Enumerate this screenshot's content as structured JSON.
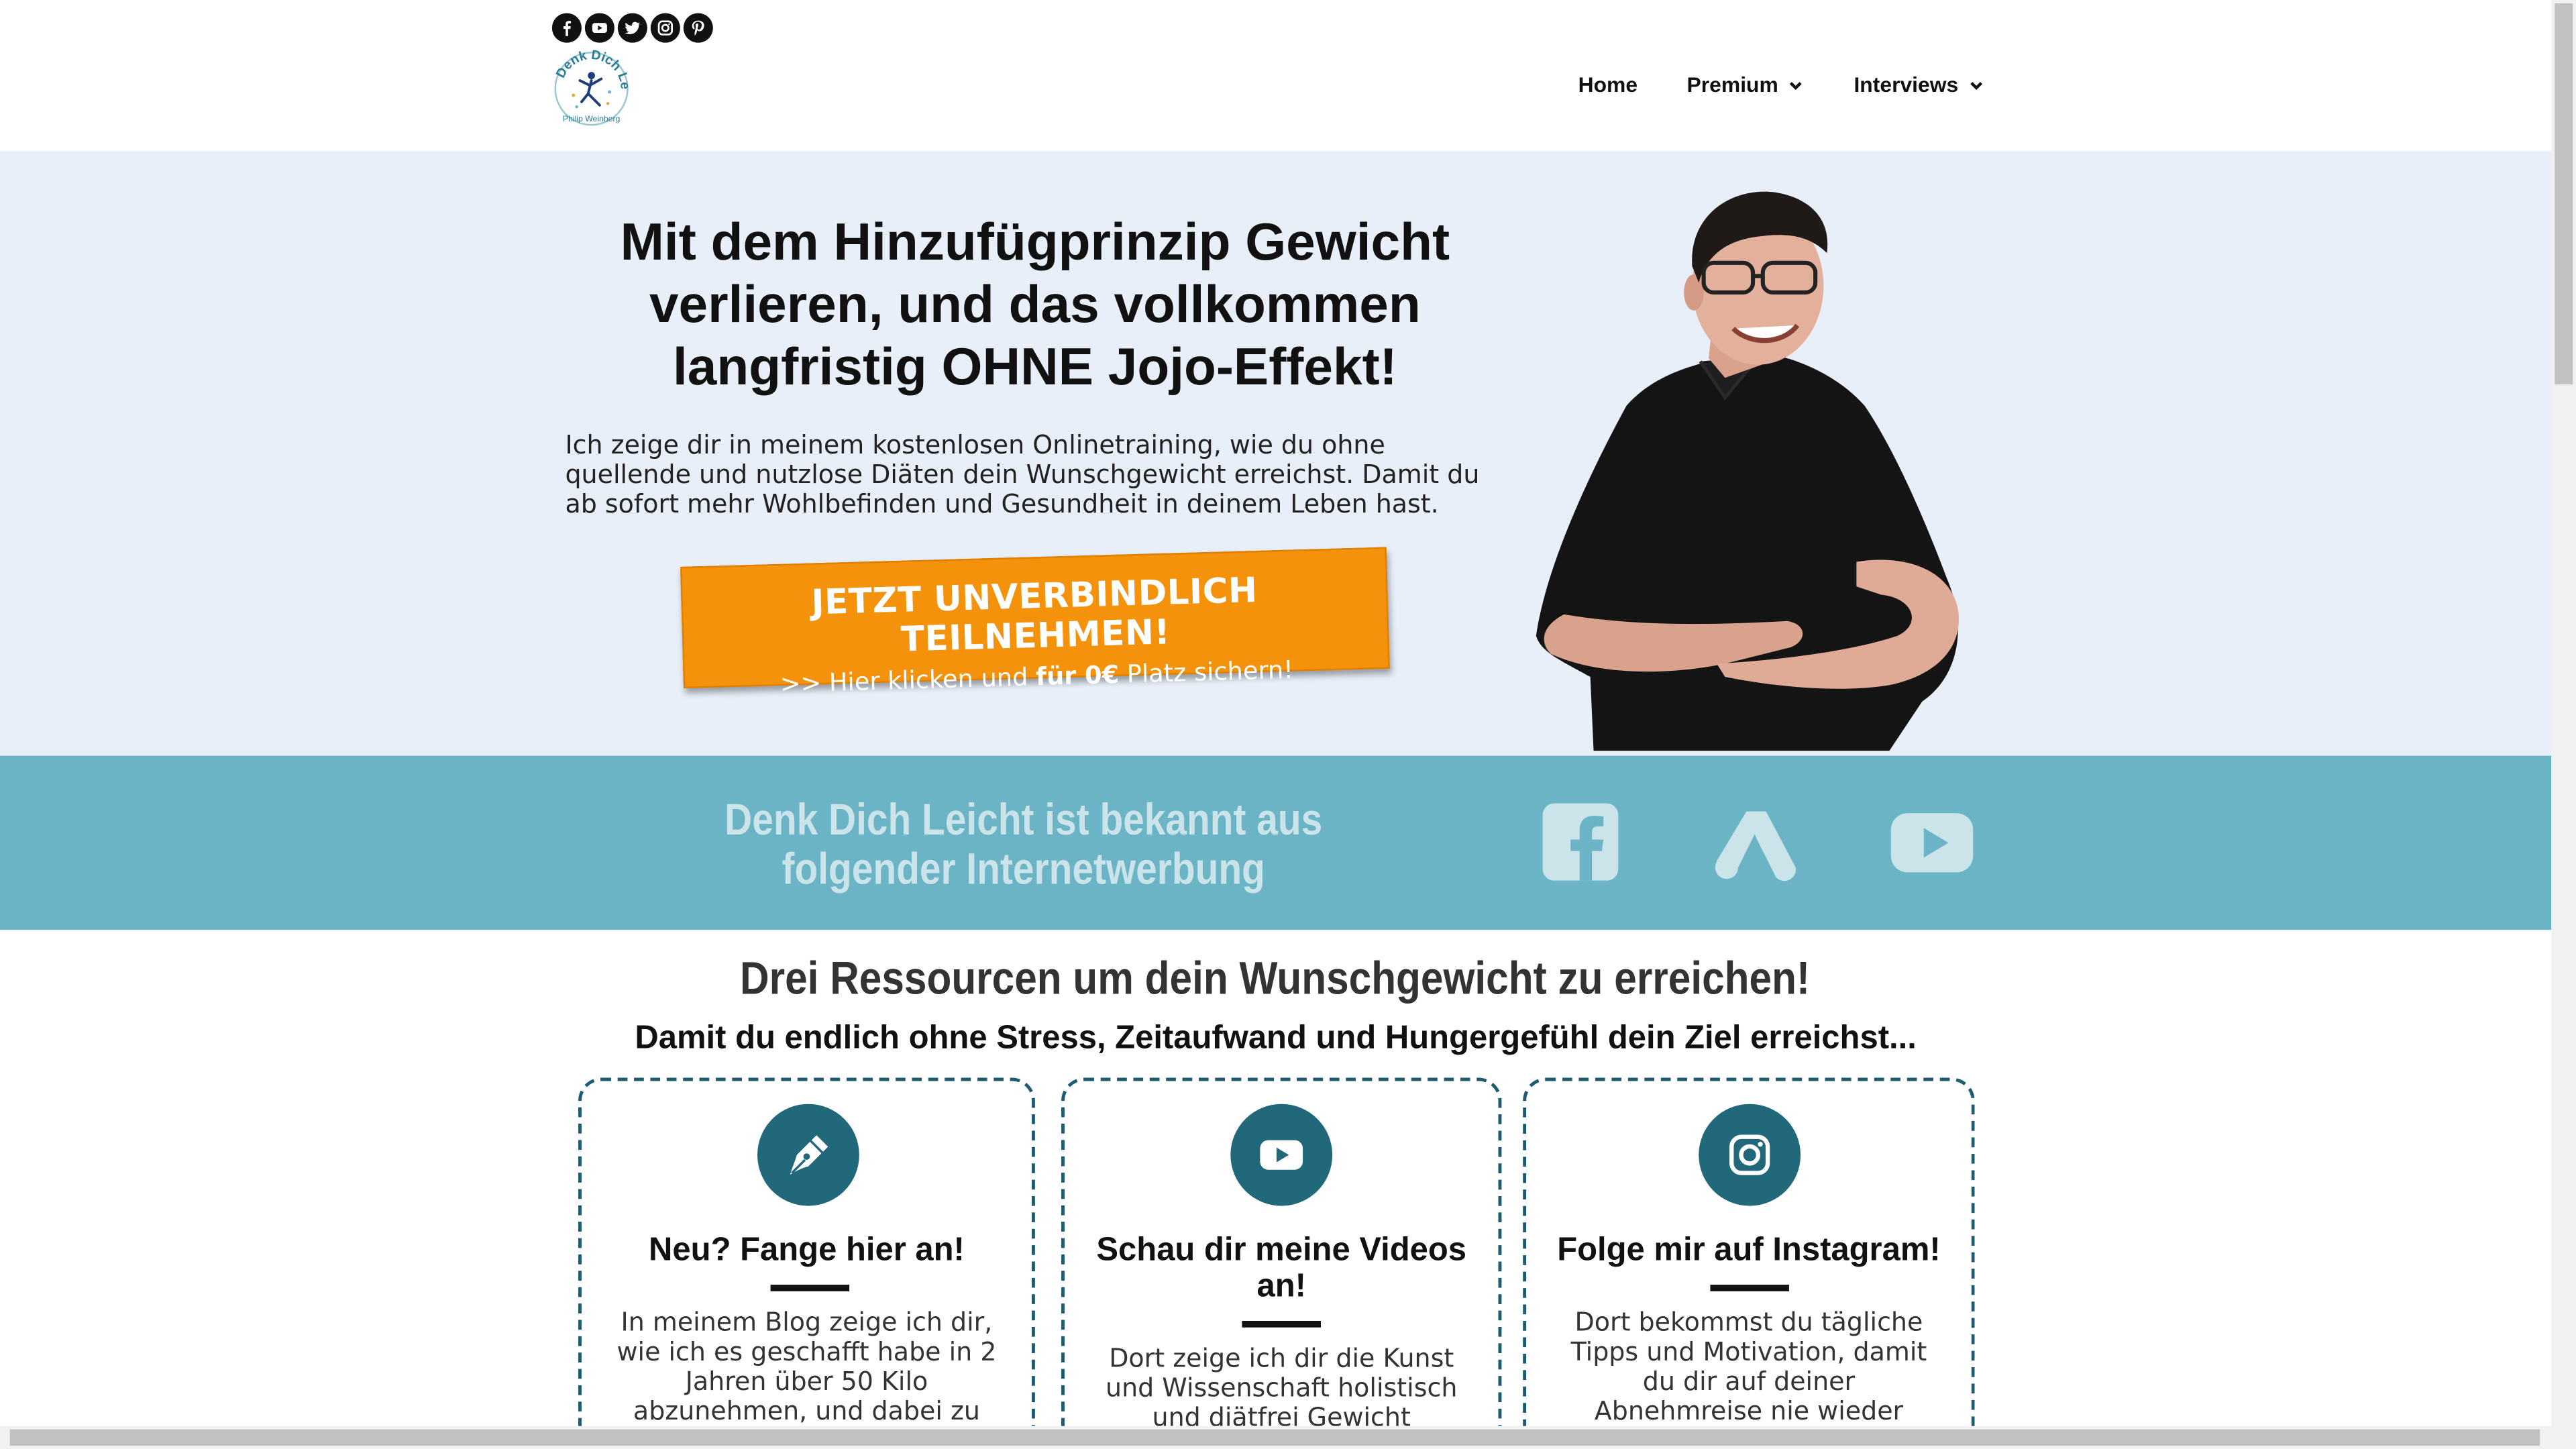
{
  "header": {
    "social_icons": [
      "facebook-icon",
      "youtube-icon",
      "twitter-icon",
      "instagram-icon",
      "pinterest-icon"
    ],
    "logo_text": "Denk Dich Leicht",
    "nav": [
      {
        "label": "Home",
        "has_dropdown": false
      },
      {
        "label": "Premium",
        "has_dropdown": true
      },
      {
        "label": "Interviews",
        "has_dropdown": true
      }
    ]
  },
  "hero": {
    "title": "Mit dem Hinzufügprinzip Gewicht verlieren, und das vollkommen langfristig OHNE Jojo-Effekt!",
    "text": "Ich zeige dir in meinem kostenlosen Onlinetraining, wie du ohne quellende und nutzlose Diäten dein Wunschgewicht erreichst. Damit du ab sofort mehr Wohlbefinden und Gesundheit in deinem Leben hast.",
    "cta_main": "JETZT UNVERBINDLICH TEILNEHMEN!",
    "cta_sub_pre": ">> Hier klicken und ",
    "cta_sub_bold": "für 0€",
    "cta_sub_post": " Platz sichern!"
  },
  "press": {
    "text": "Denk Dich Leicht ist bekannt aus folgender Internetwerbung",
    "icons": [
      "facebook-icon",
      "google-ads-icon",
      "youtube-icon"
    ]
  },
  "resources": {
    "title": "Drei Ressourcen um dein Wunschgewicht zu erreichen!",
    "subtitle": "Damit du endlich ohne Stress, Zeitaufwand und Hungergefühl dein Ziel erreichst...",
    "cards": [
      {
        "icon": "pen-icon",
        "title": "Neu? Fange hier an!",
        "text": "In meinem Blog zeige ich dir, wie ich es geschafft habe in 2 Jahren über 50 Kilo abzunehmen, und dabei zu"
      },
      {
        "icon": "youtube-icon",
        "title": "Schau dir meine Videos an!",
        "text": "Dort zeige ich dir die Kunst und Wissenschaft holistisch und diätfrei Gewicht"
      },
      {
        "icon": "instagram-icon",
        "title": "Folge mir auf Instagram!",
        "text": "Dort bekommst du tägliche Tipps und Motivation, damit du dir auf deiner Abnehmreise nie wieder Gedanken über Hunger"
      }
    ]
  },
  "colors": {
    "hero_bg": "#e8eff9",
    "band_bg": "#6bb4c6",
    "cta": "#f4920b",
    "icon_circle": "#21687a"
  }
}
